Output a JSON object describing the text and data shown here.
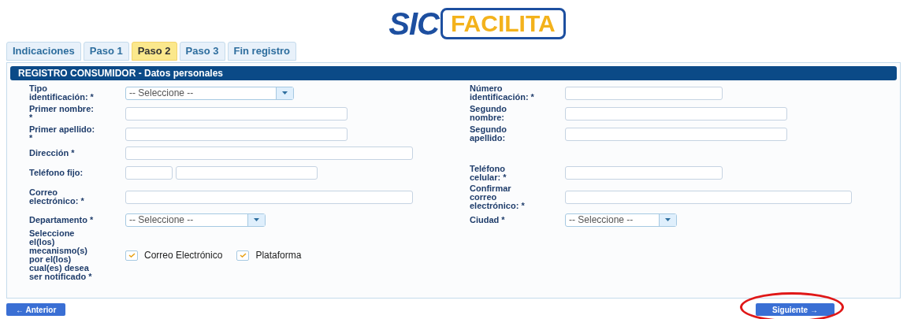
{
  "logo": {
    "part_1": "SIC",
    "part_2": "FACILITA"
  },
  "tabs": [
    {
      "label": "Indicaciones",
      "selected": false
    },
    {
      "label": "Paso 1",
      "selected": false
    },
    {
      "label": "Paso 2",
      "selected": true
    },
    {
      "label": "Paso 3",
      "selected": false
    },
    {
      "label": "Fin registro",
      "selected": false
    }
  ],
  "panel": {
    "title": "REGISTRO CONSUMIDOR - Datos personales"
  },
  "rows": [
    {
      "left": {
        "label": "Tipo identificación: *",
        "kind": "select",
        "value": "-- Seleccione --"
      },
      "right": {
        "label": "Número identificación: *",
        "kind": "input"
      }
    },
    {
      "left": {
        "label": "Primer nombre: *",
        "kind": "input"
      },
      "right": {
        "label": "Segundo nombre:",
        "kind": "input"
      }
    },
    {
      "left": {
        "label": "Primer apellido: *",
        "kind": "input"
      },
      "right": {
        "label": "Segundo apellido:",
        "kind": "input"
      }
    },
    {
      "left": {
        "label": "Dirección *",
        "kind": "wide"
      }
    },
    {
      "left": {
        "label": "Teléfono fijo:",
        "kind": "phone"
      },
      "right": {
        "label": "Teléfono celular: *",
        "kind": "input"
      }
    },
    {
      "left": {
        "label": "Correo electrónico: *",
        "kind": "wide"
      },
      "right": {
        "label": "Confirmar correo electrónico: *",
        "kind": "wide"
      }
    },
    {
      "left": {
        "label": "Departamento *",
        "kind": "select",
        "value": "-- Seleccione --"
      },
      "right": {
        "label": "Ciudad *",
        "kind": "select",
        "value": "-- Seleccione --"
      }
    },
    {
      "left": {
        "label": "Seleccione el(los) mecanismo(s) por el(los) cual(es) desea ser notificado *",
        "kind": "checks",
        "options": [
          {
            "label": "Correo Electrónico",
            "checked": true
          },
          {
            "label": "Plataforma",
            "checked": true
          }
        ]
      }
    }
  ],
  "buttons": {
    "previous": "← Anterior",
    "next": "Siguiente →",
    "next_circled": true
  }
}
